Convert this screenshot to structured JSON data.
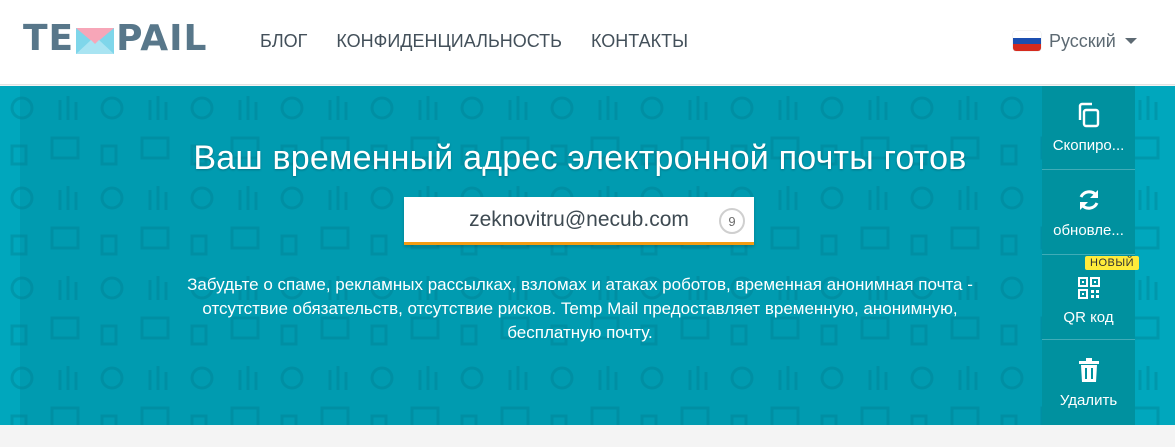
{
  "header": {
    "logo_text_left": "TE",
    "logo_text_right": "PAIL",
    "nav": [
      {
        "label": "БЛОГ"
      },
      {
        "label": "КОНФИДЕНЦИАЛЬНОСТЬ"
      },
      {
        "label": "КОНТАКТЫ"
      }
    ],
    "language": {
      "label": "Русский",
      "flag": "russia-flag-icon"
    }
  },
  "hero": {
    "title": "Ваш временный адрес электронной почты готов",
    "email": "zeknovitru@necub.com",
    "countdown": "9",
    "description": "Забудьте о спаме, рекламных рассылках, взломах и атаках роботов, временная анонимная почта - отсутствие обязательств, отсутствие рисков. Temp Mail предоставляет временную, анонимную, бесплатную почту."
  },
  "actions": [
    {
      "label": "Скопиро...",
      "icon": "copy-icon"
    },
    {
      "label": "обновле...",
      "icon": "refresh-icon"
    },
    {
      "label": "QR код",
      "icon": "qr-code-icon",
      "badge": "НОВЫЙ"
    },
    {
      "label": "Удалить",
      "icon": "trash-icon"
    }
  ],
  "colors": {
    "hero_bg": "#00a7bd",
    "actions_bg": "#00919f",
    "accent_orange": "#f39c12",
    "badge_yellow": "#ffeb3b",
    "logo_blue": "#58778a"
  }
}
